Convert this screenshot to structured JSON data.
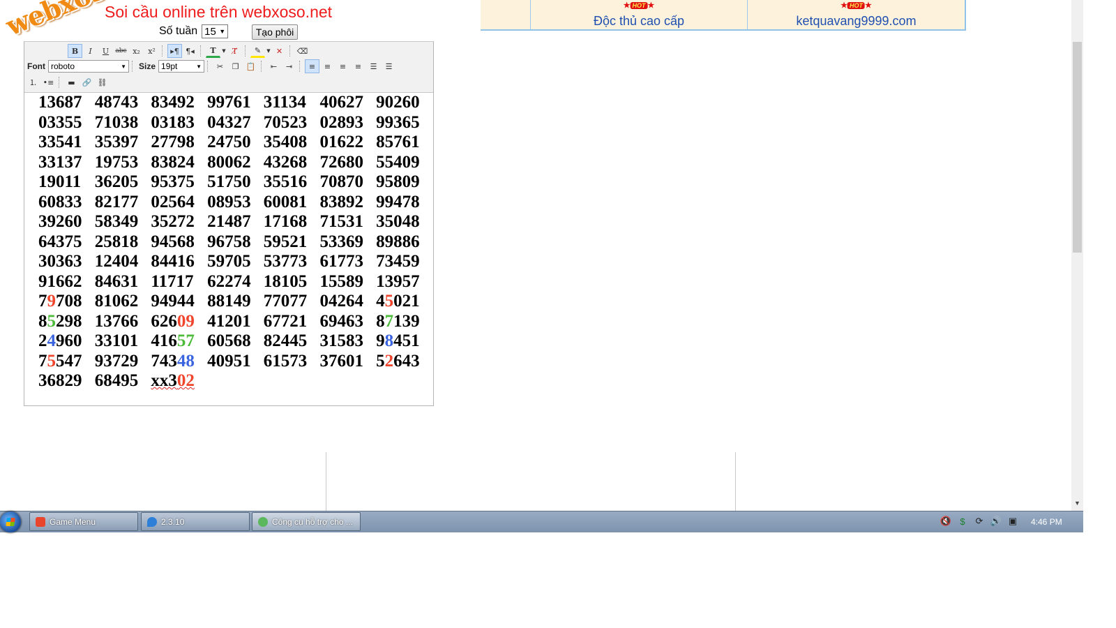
{
  "header": {
    "title": "Soi cầu online trên webxoso.net",
    "week_label": "Số tuần",
    "week_value": "15",
    "create_button": "Tạo phôi",
    "logo_text": "webxoso.net"
  },
  "banner": {
    "hot_label": "HOT",
    "links": [
      {
        "label": "Độc thủ cao cấp"
      },
      {
        "label": "ketquavang9999.com"
      }
    ]
  },
  "toolbar": {
    "font_label": "Font",
    "font_value": "roboto",
    "size_label": "Size",
    "size_value": "19pt",
    "buttons": [
      "B",
      "I",
      "U",
      "abc",
      "x₂",
      "x²"
    ]
  },
  "content": {
    "rows": [
      [
        [
          "13687"
        ],
        [
          "48743"
        ],
        [
          "83492"
        ],
        [
          "99761"
        ],
        [
          "31134"
        ],
        [
          "40627"
        ],
        [
          "90260"
        ]
      ],
      [
        [
          "03355"
        ],
        [
          "71038"
        ],
        [
          "03183"
        ],
        [
          "04327"
        ],
        [
          "70523"
        ],
        [
          "02893"
        ],
        [
          "99365"
        ]
      ],
      [
        [
          "33541"
        ],
        [
          "35397"
        ],
        [
          "27798"
        ],
        [
          "24750"
        ],
        [
          "35408"
        ],
        [
          "01622"
        ],
        [
          "85761"
        ]
      ],
      [
        [
          "33137"
        ],
        [
          "19753"
        ],
        [
          "83824"
        ],
        [
          "80062"
        ],
        [
          "43268"
        ],
        [
          "72680"
        ],
        [
          "55409"
        ]
      ],
      [
        [
          "19011"
        ],
        [
          "36205"
        ],
        [
          "95375"
        ],
        [
          "51750"
        ],
        [
          "35516"
        ],
        [
          "70870"
        ],
        [
          "95809"
        ]
      ],
      [
        [
          "60833"
        ],
        [
          "82177"
        ],
        [
          "02564"
        ],
        [
          "08953"
        ],
        [
          "60081"
        ],
        [
          "83892"
        ],
        [
          "99478"
        ]
      ],
      [
        [
          "39260"
        ],
        [
          "58349"
        ],
        [
          "35272"
        ],
        [
          "21487"
        ],
        [
          "17168"
        ],
        [
          "71531"
        ],
        [
          "35048"
        ]
      ],
      [
        [
          "64375"
        ],
        [
          "25818"
        ],
        [
          "94568"
        ],
        [
          "96758"
        ],
        [
          "59521"
        ],
        [
          "53369"
        ],
        [
          "89886"
        ]
      ],
      [
        [
          "30363"
        ],
        [
          "12404"
        ],
        [
          "84416"
        ],
        [
          "59705"
        ],
        [
          "53773"
        ],
        [
          "61773"
        ],
        [
          "73459"
        ]
      ],
      [
        [
          "91662"
        ],
        [
          "84631"
        ],
        [
          "11717"
        ],
        [
          "62274"
        ],
        [
          "18105"
        ],
        [
          "15589"
        ],
        [
          "13957"
        ]
      ],
      [
        [
          "7",
          ""
        ],
        [
          "9",
          "red"
        ],
        [
          "708",
          ""
        ],
        [
          "81062"
        ],
        [
          "94944"
        ],
        [
          "88149"
        ],
        [
          "77077"
        ],
        [
          "04264"
        ],
        [
          "4",
          ""
        ],
        [
          "5",
          "red"
        ],
        [
          "021",
          ""
        ]
      ],
      [
        [
          "8",
          ""
        ],
        [
          "5",
          "green"
        ],
        [
          "298",
          ""
        ],
        [
          "13766"
        ],
        [
          "626",
          ""
        ],
        [
          "09",
          "red"
        ],
        [
          "41201"
        ],
        [
          "67721"
        ],
        [
          "69463"
        ],
        [
          "8",
          ""
        ],
        [
          "7",
          "green"
        ],
        [
          "139",
          ""
        ]
      ],
      [
        [
          "2",
          ""
        ],
        [
          "4",
          "blue"
        ],
        [
          "960",
          ""
        ],
        [
          "33101"
        ],
        [
          "416",
          ""
        ],
        [
          "57",
          "green"
        ],
        [
          "60568"
        ],
        [
          "82445"
        ],
        [
          "31583"
        ],
        [
          "9",
          ""
        ],
        [
          "8",
          "blue"
        ],
        [
          "451",
          ""
        ]
      ],
      [
        [
          "7",
          ""
        ],
        [
          "5",
          "red"
        ],
        [
          "547",
          ""
        ],
        [
          "93729"
        ],
        [
          "743",
          ""
        ],
        [
          "48",
          "blue"
        ],
        [
          "40951"
        ],
        [
          "61573"
        ],
        [
          "37601"
        ],
        [
          "5",
          ""
        ],
        [
          "2",
          "red"
        ],
        [
          "643",
          ""
        ]
      ],
      [
        [
          "36829"
        ],
        [
          "68495"
        ],
        [
          "xx3",
          ""
        ],
        [
          "02",
          "red"
        ]
      ]
    ]
  },
  "taskbar": {
    "tasks": [
      {
        "label": "Game Menu",
        "color": "#e8452c"
      },
      {
        "label": "2.3.10",
        "color": "#2d7fd8"
      },
      {
        "label": "Công cụ hỗ trợ cho ...",
        "color": "#5cb85c"
      }
    ],
    "clock": "4:46 PM"
  },
  "colors": {
    "title_red": "#ee1c1c",
    "link_blue": "#1f4fb0",
    "digit_red": "#f0442c",
    "digit_green": "#4dbb3a",
    "digit_blue": "#3a63e0"
  }
}
